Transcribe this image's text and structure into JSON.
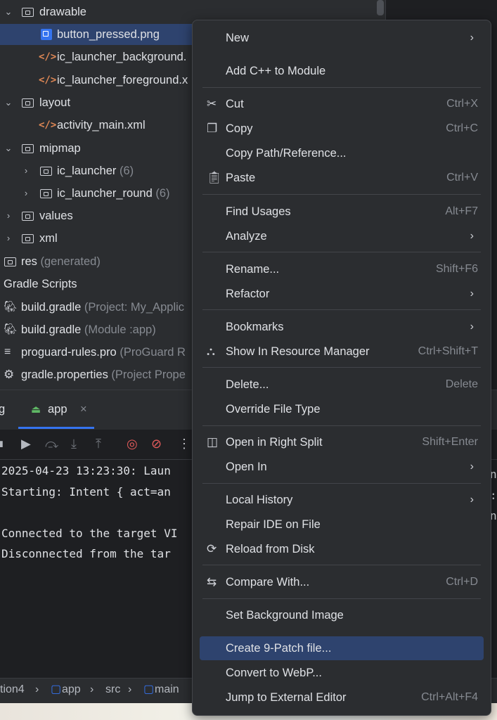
{
  "tree": {
    "items": [
      {
        "label": "drawable",
        "extra": "",
        "icon": "folder-icon"
      },
      {
        "label": "button_pressed.png",
        "extra": "",
        "icon": "image-file-icon"
      },
      {
        "label": "ic_launcher_background.",
        "extra": "",
        "icon": "xml-file-icon"
      },
      {
        "label": "ic_launcher_foreground.x",
        "extra": "",
        "icon": "xml-file-icon"
      },
      {
        "label": "layout",
        "extra": "",
        "icon": "folder-icon"
      },
      {
        "label": "activity_main.xml",
        "extra": "",
        "icon": "xml-file-icon"
      },
      {
        "label": "mipmap",
        "extra": "",
        "icon": "folder-icon"
      },
      {
        "label": "ic_launcher",
        "extra": "(6)",
        "icon": "folder-icon"
      },
      {
        "label": "ic_launcher_round",
        "extra": "(6)",
        "icon": "folder-icon"
      },
      {
        "label": "values",
        "extra": "",
        "icon": "folder-icon"
      },
      {
        "label": "xml",
        "extra": "",
        "icon": "folder-icon"
      },
      {
        "label": "res",
        "extra": "(generated)",
        "icon": "folder-icon"
      },
      {
        "label": "Gradle Scripts",
        "extra": "",
        "icon": ""
      },
      {
        "label": "build.gradle",
        "extra": "(Project: My_Applic",
        "icon": "gradle-icon"
      },
      {
        "label": "build.gradle",
        "extra": "(Module :app)",
        "icon": "gradle-icon"
      },
      {
        "label": "proguard-rules.pro",
        "extra": "(ProGuard R",
        "icon": "text-file-icon"
      },
      {
        "label": "gradle.properties",
        "extra": "(Project Prope",
        "icon": "gear-icon"
      }
    ]
  },
  "bottom_panel": {
    "tab_label": "app",
    "tab_left_fragment": "g",
    "console_lines": [
      "2025-04-23 13:23:30: Laun",
      "Starting: Intent { act=an",
      "",
      "Connected to the target VI",
      "Disconnected from the tar"
    ],
    "right_fragments": [
      "nt",
      "",
      ":",
      "ns"
    ]
  },
  "breadcrumbs": [
    "tion4",
    "app",
    "src",
    "main"
  ],
  "menu": {
    "items": [
      {
        "label": "New",
        "mnemonic": "N",
        "shortcut": "",
        "submenu": true,
        "icon": ""
      },
      {
        "label": "Add C++ to Module",
        "shortcut": "",
        "submenu": false,
        "icon": ""
      },
      {
        "label": "Cut",
        "shortcut": "Ctrl+X",
        "submenu": false,
        "icon": "scissors-icon"
      },
      {
        "label": "Copy",
        "shortcut": "Ctrl+C",
        "submenu": false,
        "icon": "copy-icon"
      },
      {
        "label": "Copy Path/Reference...",
        "shortcut": "",
        "submenu": false,
        "icon": ""
      },
      {
        "label": "Paste",
        "shortcut": "Ctrl+V",
        "submenu": false,
        "icon": "paste-icon"
      },
      {
        "label": "Find Usages",
        "shortcut": "Alt+F7",
        "submenu": false,
        "icon": ""
      },
      {
        "label": "Analyze",
        "shortcut": "",
        "submenu": true,
        "icon": ""
      },
      {
        "label": "Rename...",
        "shortcut": "Shift+F6",
        "submenu": false,
        "icon": ""
      },
      {
        "label": "Refactor",
        "shortcut": "",
        "submenu": true,
        "icon": ""
      },
      {
        "label": "Bookmarks",
        "shortcut": "",
        "submenu": true,
        "icon": ""
      },
      {
        "label": "Show In Resource Manager",
        "shortcut": "Ctrl+Shift+T",
        "submenu": false,
        "icon": "resource-manager-icon"
      },
      {
        "label": "Delete...",
        "shortcut": "Delete",
        "submenu": false,
        "icon": ""
      },
      {
        "label": "Override File Type",
        "shortcut": "",
        "submenu": false,
        "icon": ""
      },
      {
        "label": "Open in Right Split",
        "shortcut": "Shift+Enter",
        "submenu": false,
        "icon": "split-icon"
      },
      {
        "label": "Open In",
        "shortcut": "",
        "submenu": true,
        "icon": ""
      },
      {
        "label": "Local History",
        "shortcut": "",
        "submenu": true,
        "icon": ""
      },
      {
        "label": "Repair IDE on File",
        "shortcut": "",
        "submenu": false,
        "icon": ""
      },
      {
        "label": "Reload from Disk",
        "shortcut": "",
        "submenu": false,
        "icon": "reload-icon"
      },
      {
        "label": "Compare With...",
        "shortcut": "Ctrl+D",
        "submenu": false,
        "icon": "compare-icon"
      },
      {
        "label": "Set Background Image",
        "shortcut": "",
        "submenu": false,
        "icon": ""
      },
      {
        "label": "Create 9-Patch file...",
        "shortcut": "",
        "submenu": false,
        "icon": "",
        "highlighted": true
      },
      {
        "label": "Convert to WebP...",
        "shortcut": "",
        "submenu": false,
        "icon": ""
      },
      {
        "label": "Jump to External Editor",
        "shortcut": "Ctrl+Alt+F4",
        "submenu": false,
        "icon": ""
      }
    ]
  }
}
